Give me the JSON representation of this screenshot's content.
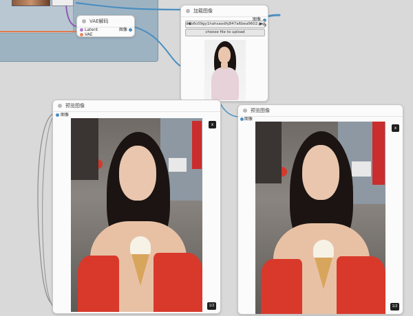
{
  "vae_decode_node": {
    "title": "VAE解码",
    "inputs": [
      "Latent",
      "VAE"
    ],
    "output": "图像"
  },
  "load_image_node": {
    "title": "加载图像",
    "outputs": [
      "图像",
      "遮罩"
    ],
    "filename": "d6b6c09gy1hahsaodhj847a6bea9602.jpg",
    "upload_button": "choose file to upload"
  },
  "preview_node_left": {
    "title": "预览图像",
    "input": "图像",
    "close_label": "x",
    "page_counter": "1/2"
  },
  "preview_node_right": {
    "title": "预览图像",
    "input": "图像",
    "close_label": "x",
    "page_counter": "1/2"
  },
  "colors": {
    "canvas": "#d9d9d9",
    "group": "#9eb3c2",
    "link_image": "#4a8ec0",
    "link_latent": "#8d5ab2",
    "link_vae": "#e07a4a",
    "socket_latent": "#b07ad0",
    "socket_vae": "#e9885a",
    "socket_image": "#4a8ec0",
    "socket_mask": "#7a7a7a"
  }
}
